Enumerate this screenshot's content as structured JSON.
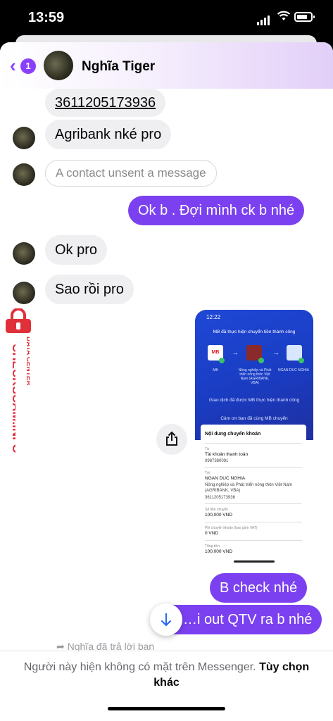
{
  "status_bar": {
    "time": "13:59"
  },
  "header": {
    "back_badge": "1",
    "contact_name": "Nghĩa Tiger"
  },
  "messages": [
    {
      "from": "them",
      "text": "3611205173936"
    },
    {
      "from": "them",
      "text": "Agribank nké pro"
    },
    {
      "from": "them",
      "text": "A contact unsent a message"
    },
    {
      "from": "me",
      "text": "Ok b . Đợi mình ck b nhé"
    },
    {
      "from": "them",
      "text": "Ok pro"
    },
    {
      "from": "them",
      "text": "Sao rồi pro"
    },
    {
      "from": "me",
      "text": "B check nhé"
    },
    {
      "from": "me",
      "text": "…i out QTV ra b nhé"
    }
  ],
  "receipt": {
    "time": "12:22",
    "title": "MB đã thực hiện chuyển tiền thành công",
    "bank_from": "MB",
    "bank_mid": "Nông nghiệp và Phát triển nông thôn Việt Nam (AGRIBANK, VBA)",
    "bank_to": "NGAN DUC NGHIA",
    "success_msg": "Giao dịch đã được MB thực hiện thành công",
    "thanks_msg": "Cảm ơn bạn đã cùng MB chuyển",
    "card_title": "Nội dung chuyển khoản",
    "from_label": "Từ",
    "from_account": "Tài khoản thanh toán",
    "from_number": "0987380091",
    "to_label": "Tới",
    "to_name": "NGAN DUC NGHIA",
    "to_bank": "Nông nghiệp và Phát triển nông thôn Việt Nam (AGRIBANK, VBA)",
    "to_number": "3611205173936",
    "amount_label": "Số tiền chuyển",
    "amount": "100,000 VND",
    "fee_label": "Phí chuyển khoản (bao gồm VAT)",
    "fee": "0 VND",
    "total_label": "Tổng tiền",
    "total": "100,000 VND"
  },
  "replied_note": "Nghĩa đã trả lời bạn",
  "footer": {
    "notice": "Người này hiện không có mặt trên Messenger.",
    "action": "Tùy chọn khác"
  },
  "watermark": {
    "line1": "DATA CENTER",
    "line2": "CHECKSCAM.INFO"
  },
  "colors": {
    "accent": "#7b41f0",
    "incoming_bubble": "#efeff1",
    "watermark": "#e0313b"
  },
  "icons": [
    "back-chevron-icon",
    "share-icon",
    "arrow-down-icon",
    "lock-icon"
  ]
}
